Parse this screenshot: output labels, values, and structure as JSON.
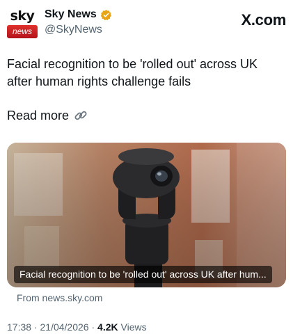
{
  "account": {
    "avatar_top": "sky",
    "avatar_bottom": "news",
    "display_name": "Sky News",
    "handle": "@SkyNews",
    "verified_color": "#e8a317"
  },
  "brand": "X.com",
  "tweet": {
    "text": "Facial recognition to be 'rolled out' across UK after human rights challenge fails",
    "read_more": "Read more"
  },
  "card": {
    "caption": "Facial recognition to be 'rolled out' across UK after hum...",
    "source": "From news.sky.com"
  },
  "meta": {
    "time": "17:38",
    "separator": "·",
    "date": "21/04/2026",
    "views_count": "4.2K",
    "views_label": "Views"
  },
  "icons": {
    "verified": "verified-badge-icon",
    "link": "link-chain-icon"
  }
}
